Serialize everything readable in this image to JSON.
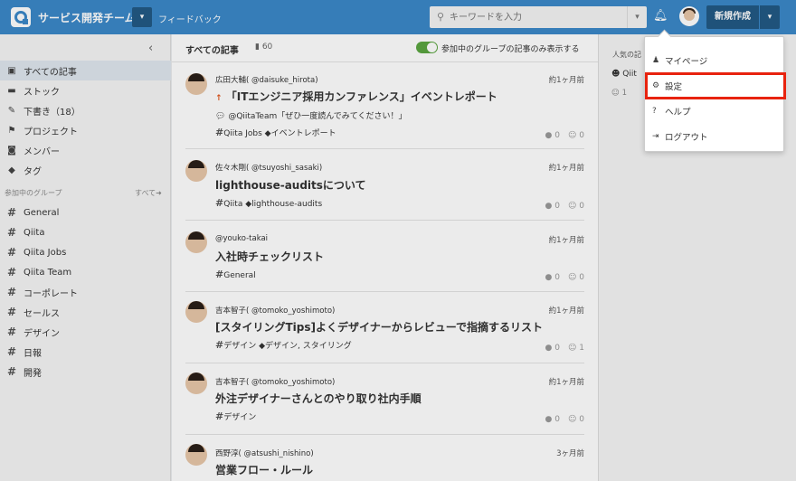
{
  "header": {
    "team_name": "サービス開発チーム",
    "team_dropdown_icon": "▾",
    "feedback_label": "フィードバック",
    "search_placeholder": "キーワードを入力",
    "new_post_label": "新規作成"
  },
  "sidebar": {
    "items": [
      {
        "icon": "rss-icon",
        "label": "すべての記事",
        "active": true
      },
      {
        "icon": "folder-icon",
        "label": "ストック"
      },
      {
        "icon": "pencil-icon",
        "label": "下書き（18）"
      },
      {
        "icon": "flag-icon",
        "label": "プロジェクト"
      },
      {
        "icon": "member-icon",
        "label": "メンバー"
      },
      {
        "icon": "tag-icon",
        "label": "タグ"
      }
    ],
    "groups_heading": "参加中のグループ",
    "groups_all": "すべて➜",
    "groups": [
      "General",
      "Qiita",
      "Qiita Jobs",
      "Qiita Team",
      "コーポレート",
      "セールス",
      "デザイン",
      "日報",
      "開発"
    ]
  },
  "main": {
    "title": "すべての記事",
    "count": "60",
    "toggle_label": "参加中のグループの記事のみ表示する",
    "toggle_on": true,
    "articles": [
      {
        "author": "広田大輔( @daisuke_hirota)",
        "time": "約1ヶ月前",
        "title": "「ITエンジニア採用カンファレンス」イベントレポート",
        "comment": "@QiitaTeam「ぜひ一度読んでみてください！」",
        "group": "Qiita Jobs",
        "tags": "イベントレポート",
        "comments": "0",
        "likes": "0"
      },
      {
        "author": "佐々木剛( @tsuyoshi_sasaki)",
        "time": "約1ヶ月前",
        "title": "lighthouse-auditsについて",
        "group": "Qiita",
        "tags": "lighthouse-audits",
        "comments": "0",
        "likes": "0"
      },
      {
        "author": "@youko-takai",
        "time": "約1ヶ月前",
        "title": "入社時チェックリスト",
        "group": "General",
        "tags": "",
        "comments": "0",
        "likes": "0"
      },
      {
        "author": "吉本智子( @tomoko_yoshimoto)",
        "time": "約1ヶ月前",
        "title": "[スタイリングTips]よくデザイナーからレビューで指摘するリスト",
        "group": "デザイン",
        "tags": "デザイン, スタイリング",
        "comments": "0",
        "likes": "1"
      },
      {
        "author": "吉本智子( @tomoko_yoshimoto)",
        "time": "約1ヶ月前",
        "title": "外注デザイナーさんとのやり取り社内手順",
        "group": "デザイン",
        "tags": "",
        "comments": "0",
        "likes": "0"
      },
      {
        "author": "西野淳( @atsushi_nishino)",
        "time": "3ヶ月前",
        "title": "営業フロー・ルール"
      }
    ]
  },
  "right_panel": {
    "popular_label": "人気の記",
    "item_label": "Qiit",
    "item_count": "1"
  },
  "dropdown": {
    "items": [
      "マイページ",
      "設定",
      "ヘルプ",
      "ログアウト"
    ]
  },
  "highlight_color": "#e8230e",
  "accent_color": "#3b88c8"
}
